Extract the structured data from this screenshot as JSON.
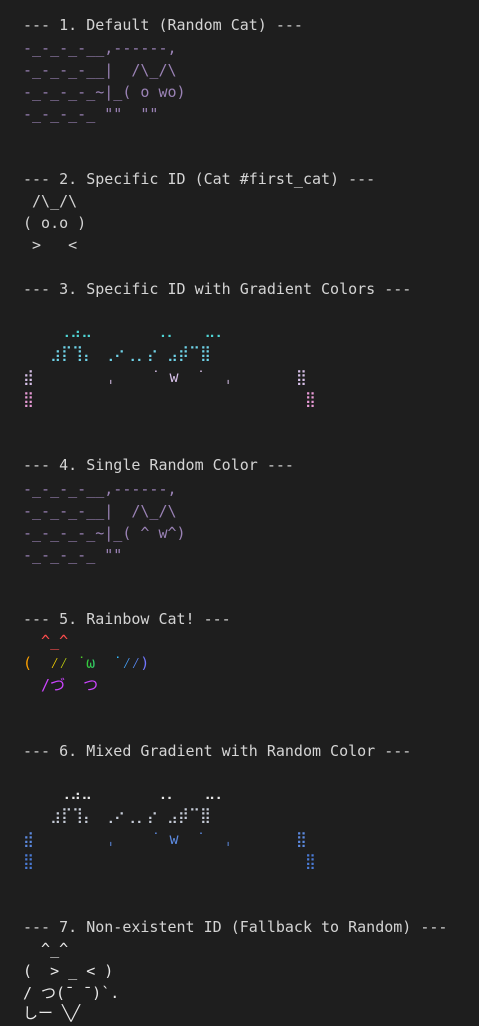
{
  "sections": [
    {
      "header": "--- 1. Default (Random Cat) ---",
      "lines": [
        "-_-_-_-__,------,",
        "-_-_-_-__|  /\\_/\\",
        "-_-_-_-_~|_( o wo)",
        "-_-_-_-_ \"\"  \"\""
      ]
    },
    {
      "header": "--- 2. Specific ID (Cat #first_cat) ---",
      "lines": [
        " /\\_/\\",
        "( o.o )",
        " >   <"
      ]
    },
    {
      "header": "--- 3. Specific ID with Gradient Colors ---",
      "lines": [
        "    ⢀⣠⣀       ⢀⡀   ⣀⡀",
        "   ⣰⡏⢹⡄ ⢀⠔⢀⡀⡔ ⣠⡾⠉⣿",
        "⣾        ˌ    ˙ w  ˙  ˌ       ⣿",
        "⣿                              ⣿"
      ]
    },
    {
      "header": "--- 4. Single Random Color ---",
      "lines": [
        "-_-_-_-__,------,",
        "-_-_-_-__|  /\\_/\\",
        "-_-_-_-_~|_( ^ w^)",
        "-_-_-_-_ \"\""
      ]
    },
    {
      "header": "--- 5. Rainbow Cat! ---",
      "lines": [
        "  ^_^",
        "(  ⁄⁄ ˙ω  ˙⁄⁄)",
        "  /づ  つ"
      ]
    },
    {
      "header": "--- 6. Mixed Gradient with Random Color ---",
      "lines": [
        "    ⢀⣠⣀       ⢀⡀   ⣀⡀",
        "   ⣰⡏⢹⡄ ⢀⠔⢀⡀⡔ ⣠⡾⠉⣿",
        "⣾        ˌ    ˙ w  ˙  ˌ       ⣿",
        "⣿                              ⣿"
      ]
    },
    {
      "header": "--- 7. Non-existent ID (Fallback to Random) ---",
      "lines": [
        "  ^_^",
        "(  > _ < )",
        "/ つ(¯ ¯)`.",
        "しー ╲╱"
      ]
    }
  ],
  "colors": {
    "background": "#1e1e1e",
    "header_text": "#d4d4d4",
    "cat1": "#9a82b5",
    "cat2": "#d4d4d4",
    "gradient_top": "#4fd6d6",
    "gradient_mid": "#6fd3e8",
    "gradient_bottom": "#e89ad6",
    "cat4": "#9a82b5",
    "rainbow": [
      "#ff4d4d",
      "#ff9900",
      "#ffd800",
      "#33cc33",
      "#33bbff",
      "#7a6bff",
      "#cc44ff"
    ],
    "mixed_gradient_top": "#e8e8e8",
    "mixed_gradient_bottom": "#4a7bd6",
    "cat7": "#e8e8e8"
  }
}
